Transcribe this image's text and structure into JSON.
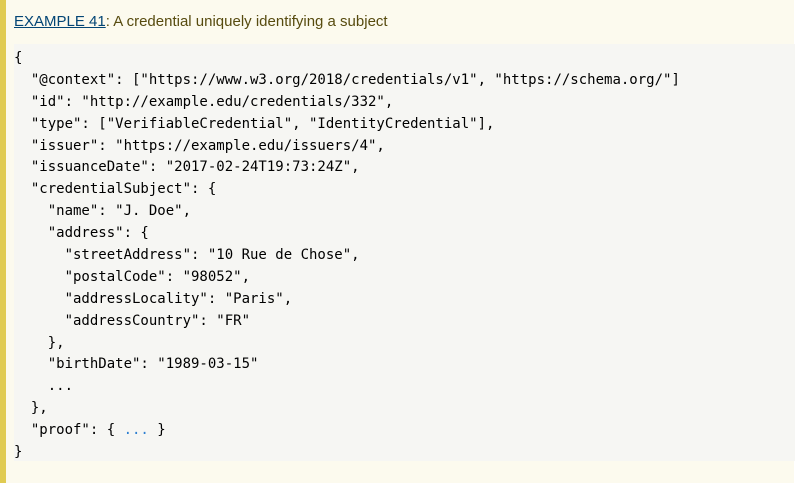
{
  "example": {
    "label": "EXAMPLE 41",
    "separator": ": ",
    "title": "A credential uniquely identifying a subject"
  },
  "code": {
    "lines": [
      "{",
      "  \"@context\": [\"https://www.w3.org/2018/credentials/v1\", \"https://schema.org/\"]",
      "  \"id\": \"http://example.edu/credentials/332\",",
      "  \"type\": [\"VerifiableCredential\", \"IdentityCredential\"],",
      "  \"issuer\": \"https://example.edu/issuers/4\",",
      "  \"issuanceDate\": \"2017-02-24T19:73:24Z\",",
      "  \"credentialSubject\": {",
      "    \"name\": \"J. Doe\",",
      "    \"address\": {",
      "      \"streetAddress\": \"10 Rue de Chose\",",
      "      \"postalCode\": \"98052\",",
      "      \"addressLocality\": \"Paris\",",
      "      \"addressCountry\": \"FR\"",
      "    },",
      "    \"birthDate\": \"1989-03-15\"",
      "    ...",
      "  },",
      "  \"proof\": { ",
      "}"
    ],
    "proof_ellipsis": "...",
    "proof_close": " }"
  },
  "colors": {
    "accent_border": "#e0cb52",
    "panel_background": "#fcfaee",
    "code_background": "#f6f6f3",
    "link": "#034575",
    "header_text": "#574b0f",
    "ellipsis": "#2d7fd1"
  }
}
